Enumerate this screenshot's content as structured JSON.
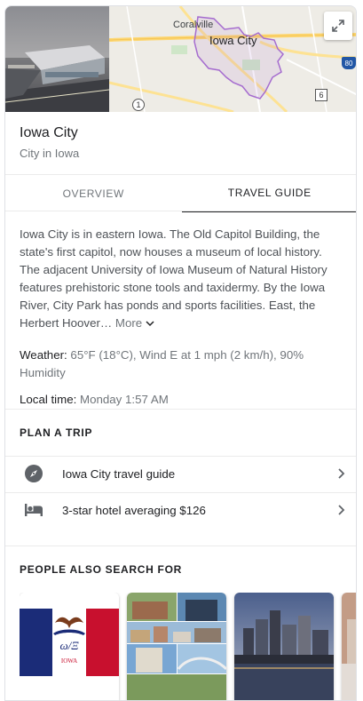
{
  "place": {
    "name": "Iowa City",
    "type": "City in Iowa"
  },
  "map": {
    "labels": [
      "Coralville",
      "Iowa City"
    ],
    "route_badges": [
      "1",
      "6",
      "80"
    ],
    "expand_icon": "expand-icon"
  },
  "tabs": [
    {
      "label": "OVERVIEW",
      "active": false
    },
    {
      "label": "TRAVEL GUIDE",
      "active": true
    }
  ],
  "description": {
    "text": "Iowa City is in eastern Iowa. The Old Capitol Building, the state's first capitol, now houses a museum of local history. The adjacent University of Iowa Museum of Natural History features prehistoric stone tools and taxidermy. By the Iowa River, City Park has ponds and sports facilities. East, the Herbert Hoover…",
    "more_label": "More"
  },
  "facts": {
    "weather_key": "Weather:",
    "weather_value": "65°F (18°C), Wind E at 1 mph (2 km/h), 90% Humidity",
    "time_key": "Local time:",
    "time_value": "Monday 1:57 AM"
  },
  "plan_trip": {
    "heading": "PLAN A TRIP",
    "items": [
      {
        "label": "Iowa City travel guide",
        "icon": "compass-icon"
      },
      {
        "label": "3-star hotel averaging $126",
        "icon": "bed-icon"
      }
    ]
  },
  "people_also_search": {
    "heading": "PEOPLE ALSO SEARCH FOR",
    "flag_text": "IOWA"
  },
  "colors": {
    "accent": "#202124",
    "muted": "#70757a",
    "map_boundary": "#a56ccf",
    "flag_blue": "#1b2c78",
    "flag_red": "#c8102e"
  }
}
